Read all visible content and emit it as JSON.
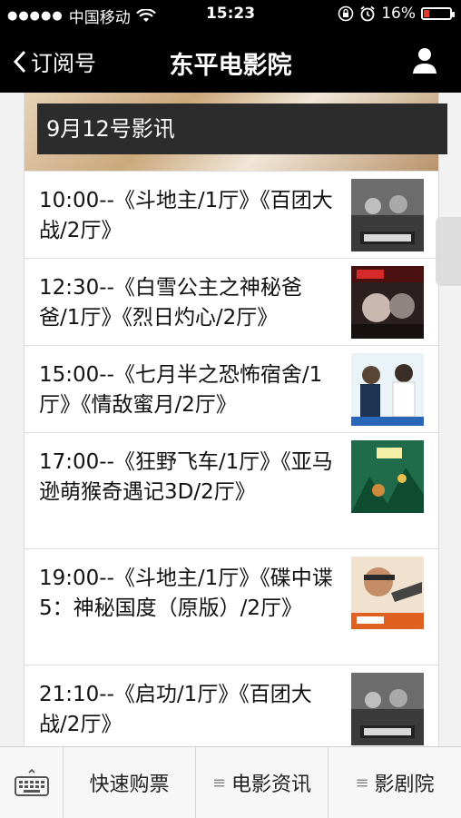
{
  "status_bar": {
    "carrier": "中国移动",
    "time": "15:23",
    "battery": "16%"
  },
  "nav": {
    "back_label": "订阅号",
    "title": "东平电影院"
  },
  "banner": {
    "caption": "9月12号影讯"
  },
  "schedule": [
    {
      "text": "10:00--《斗地主/1厅》《百团大战/2厅》",
      "poster": "baituan-dazhan-poster"
    },
    {
      "text": "12:30--《白雪公主之神秘爸爸/1厅》《烈日灼心/2厅》",
      "poster": "lieri-zhuoxin-poster"
    },
    {
      "text": "15:00--《七月半之恐怖宿舍/1厅》《情敌蜜月/2厅》",
      "poster": "qingdi-miyue-poster"
    },
    {
      "text": "17:00--《狂野飞车/1厅》《亚马逊萌猴奇遇记3D/2厅》",
      "poster": "yamaxun-menghou-poster"
    },
    {
      "text": "19:00--《斗地主/1厅》《碟中谍5：神秘国度（原版）/2厅》",
      "poster": "diezhongdie5-poster"
    },
    {
      "text": "21:10--《启功/1厅》《百团大战/2厅》",
      "poster": "baituan-dazhan-poster"
    }
  ],
  "tabbar": {
    "tab1": "快速购票",
    "tab2": "电影资讯",
    "tab3": "影剧院"
  },
  "colors": {
    "bar": "#000000",
    "battery_low": "#e23b2e"
  }
}
